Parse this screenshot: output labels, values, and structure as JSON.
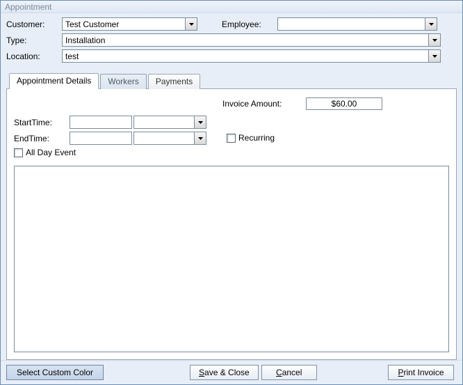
{
  "window": {
    "title": "Appointment"
  },
  "form": {
    "customer_label": "Customer:",
    "customer_value": "Test Customer",
    "employee_label": "Employee:",
    "employee_value": "",
    "type_label": "Type:",
    "type_value": "Installation",
    "location_label": "Location:",
    "location_value": "test"
  },
  "tabs": {
    "details": "Appointment Details",
    "workers": "Workers",
    "payments": "Payments"
  },
  "details": {
    "invoice_label": "Invoice Amount:",
    "invoice_value": "$60.00",
    "starttime_label": "StartTime:",
    "starttime_date": "",
    "starttime_time": "",
    "endtime_label": "EndTime:",
    "endtime_date": "",
    "endtime_time": "",
    "recurring_label": "Recurring",
    "allday_label": "All Day Event",
    "notes_value": ""
  },
  "buttons": {
    "select_color": "Select Custom Color",
    "save_close": "Save & Close",
    "cancel": "Cancel",
    "print_invoice": "Print Invoice"
  }
}
